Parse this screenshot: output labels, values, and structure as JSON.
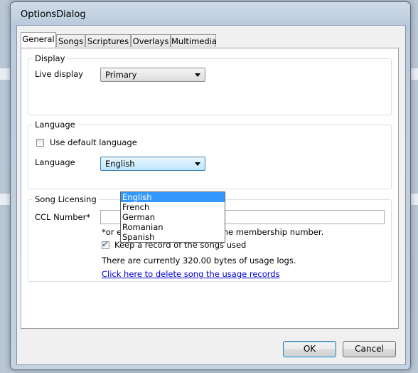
{
  "window": {
    "title": "OptionsDialog"
  },
  "tabs": [
    {
      "label": "General",
      "active": true
    },
    {
      "label": "Songs",
      "active": false
    },
    {
      "label": "Scriptures",
      "active": false
    },
    {
      "label": "Overlays",
      "active": false
    },
    {
      "label": "Multimedia",
      "active": false
    }
  ],
  "display": {
    "legend": "Display",
    "live_display_label": "Live display",
    "live_display_value": "Primary"
  },
  "language": {
    "legend": "Language",
    "use_default_label": "Use default language",
    "use_default_checked": false,
    "language_label": "Language",
    "language_value": "English",
    "options": [
      "English",
      "French",
      "German",
      "Romanian",
      "Spanish"
    ],
    "selected_option": "English"
  },
  "licensing": {
    "legend": "Song Licensing",
    "ccl_label": "CCL Number*",
    "ccl_value": "",
    "ccl_note": "*or equivalent licensing scheme membership number.",
    "keep_record_label": "Keep a record of the songs used",
    "keep_record_checked": true,
    "usage_text": "There are currently 320.00 bytes of usage logs.",
    "delete_link": "Click here to delete song the usage records"
  },
  "buttons": {
    "ok": "OK",
    "cancel": "Cancel"
  },
  "colors": {
    "selection": "#3399ff",
    "link": "#0000cc"
  }
}
